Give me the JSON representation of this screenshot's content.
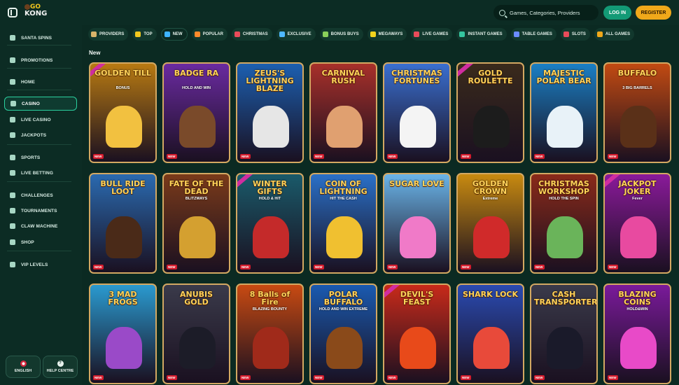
{
  "header": {
    "logo_line1": "GO",
    "logo_line2": "KONG",
    "search_placeholder": "Games, Categories, Providers",
    "login_label": "LOG IN",
    "register_label": "REGISTER"
  },
  "sidebar": {
    "items": [
      {
        "label": "SANTA SPINS",
        "icon": "snowflake-icon"
      },
      {
        "label": "PROMOTIONS",
        "icon": "gift-icon"
      },
      {
        "label": "HOME",
        "icon": "home-icon"
      },
      {
        "label": "CASINO",
        "icon": "casino-icon",
        "active": true
      },
      {
        "label": "LIVE CASINO",
        "icon": "live-casino-icon"
      },
      {
        "label": "JACKPOTS",
        "icon": "jackpot-icon"
      },
      {
        "label": "SPORTS",
        "icon": "sports-icon"
      },
      {
        "label": "LIVE BETTING",
        "icon": "live-betting-icon"
      },
      {
        "label": "CHALLENGES",
        "icon": "challenges-icon"
      },
      {
        "label": "TOURNAMENTS",
        "icon": "trophy-icon"
      },
      {
        "label": "CLAW MACHINE",
        "icon": "claw-icon"
      },
      {
        "label": "SHOP",
        "icon": "shop-icon"
      },
      {
        "label": "VIP LEVELS",
        "icon": "vip-icon"
      }
    ],
    "language_label": "ENGLISH",
    "help_label": "HELP CENTRE"
  },
  "tabs": [
    {
      "label": "PROVIDERS",
      "icon": "providers-icon",
      "color": "#d9b46a"
    },
    {
      "label": "TOP",
      "icon": "crown-icon",
      "color": "#f2c71d"
    },
    {
      "label": "NEW",
      "icon": "lightning-icon",
      "color": "#3db4ff",
      "active": true
    },
    {
      "label": "POPULAR",
      "icon": "fire-icon",
      "color": "#ff8a2b"
    },
    {
      "label": "CHRISTMAS",
      "icon": "candy-cane-icon",
      "color": "#e84b5a"
    },
    {
      "label": "EXCLUSIVE",
      "icon": "diamond-icon",
      "color": "#4fb8ff"
    },
    {
      "label": "BONUS BUYS",
      "icon": "bonus-icon",
      "color": "#8acf5a"
    },
    {
      "label": "MEGAWAYS",
      "icon": "megaways-icon",
      "color": "#f2d41d"
    },
    {
      "label": "LIVE GAMES",
      "icon": "live-icon",
      "color": "#e84b5a"
    },
    {
      "label": "INSTANT GAMES",
      "icon": "instant-icon",
      "color": "#35c7a0"
    },
    {
      "label": "TABLE GAMES",
      "icon": "table-icon",
      "color": "#6b8cff"
    },
    {
      "label": "SLOTS",
      "icon": "slots-icon",
      "color": "#e84b5a"
    },
    {
      "label": "ALL GAMES",
      "icon": "all-games-icon",
      "color": "#f0a81a"
    }
  ],
  "section_title": "New",
  "games": [
    {
      "title": "GOLDEN TILL",
      "sub": "BONUS",
      "bg": "#b87a12",
      "fig": "#f2c140"
    },
    {
      "title": "BADGE RA",
      "sub": "HOLD AND WIN",
      "bg": "#6a2aa0",
      "fig": "#7a4a2a"
    },
    {
      "title": "ZEUS'S LIGHTNING BLAZE",
      "sub": "",
      "bg": "#1c5fb0",
      "fig": "#e6e6e6"
    },
    {
      "title": "CARNIVAL RUSH",
      "sub": "",
      "bg": "#a8302a",
      "fig": "#e0a070"
    },
    {
      "title": "CHRISTMAS FORTUNES",
      "sub": "",
      "bg": "#3a6fd0",
      "fig": "#f4f4f4"
    },
    {
      "title": "GOLD ROULETTE",
      "sub": "",
      "bg": "#3a2a1c",
      "fig": "#1c1c1c"
    },
    {
      "title": "MAJESTIC POLAR BEAR",
      "sub": "",
      "bg": "#1a7fc4",
      "fig": "#e8f2f8"
    },
    {
      "title": "BUFFALO",
      "sub": "3 BIG BARRELS",
      "bg": "#c24a12",
      "fig": "#5a3018"
    },
    {
      "title": "BULL RIDE LOOT",
      "sub": "",
      "bg": "#2a6ab0",
      "fig": "#4a2a18"
    },
    {
      "title": "FATE OF THE DEAD",
      "sub": "BLITZWAYS",
      "bg": "#7a3a1a",
      "fig": "#d4a030"
    },
    {
      "title": "WINTER GIFTS",
      "sub": "HOLD & HIT",
      "bg": "#1a5a6a",
      "fig": "#c42a2a"
    },
    {
      "title": "COIN OF LIGHTNING",
      "sub": "HIT THE CASH",
      "bg": "#2a70c8",
      "fig": "#f0c030"
    },
    {
      "title": "SUGAR LOVE",
      "sub": "",
      "bg": "#6ab4e8",
      "fig": "#f07ac8"
    },
    {
      "title": "GOLDEN CROWN",
      "sub": "Extreme",
      "bg": "#c88a10",
      "fig": "#d02a2a"
    },
    {
      "title": "CHRISTMAS WORKSHOP",
      "sub": "HOLD THE SPIN",
      "bg": "#8a2a1a",
      "fig": "#6ab45a"
    },
    {
      "title": "JACKPOT JOKER",
      "sub": "Fever",
      "bg": "#8a1a9a",
      "fig": "#e84aa0"
    },
    {
      "title": "3 MAD FROGS",
      "sub": "",
      "bg": "#2a9ad0",
      "fig": "#9a4ac8"
    },
    {
      "title": "ANUBIS GOLD",
      "sub": "",
      "bg": "#3a3a4a",
      "fig": "#1c1c28"
    },
    {
      "title": "8 Balls of Fire",
      "sub": "BLAZING BOUNTY",
      "bg": "#c84a12",
      "fig": "#a02a1a"
    },
    {
      "title": "POLAR BUFFALO",
      "sub": "HOLD AND WIN EXTREME",
      "bg": "#1a5ab0",
      "fig": "#8a4a1a"
    },
    {
      "title": "DEVIL'S FEAST",
      "sub": "",
      "bg": "#c82a1a",
      "fig": "#e84a1a"
    },
    {
      "title": "SHARK LOCK",
      "sub": "",
      "bg": "#2a4ab0",
      "fig": "#e84a3a"
    },
    {
      "title": "CASH TRANSPORTER",
      "sub": "",
      "bg": "#3a3a4a",
      "fig": "#1a1a2a"
    },
    {
      "title": "BLAZING COINS",
      "sub": "HOLD&WIN",
      "bg": "#7a1a9a",
      "fig": "#e84ac8"
    }
  ],
  "new_badge": "NEW"
}
